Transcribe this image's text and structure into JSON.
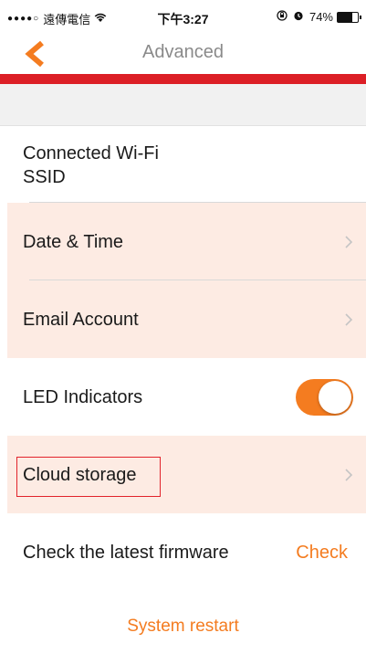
{
  "status_bar": {
    "signal": "●●●●○",
    "carrier": "遠傳電信",
    "time": "下午3:27",
    "battery_percent": "74%",
    "battery_level": 0.74
  },
  "nav": {
    "title": "Advanced"
  },
  "colors": {
    "accent": "#f47c20",
    "brand_red": "#dc1f26",
    "highlight_row": "#fdebe3",
    "outline_red": "#e2232b"
  },
  "rows": {
    "wifi": {
      "label_line1": "Connected Wi-Fi",
      "label_line2": "SSID"
    },
    "date_time": {
      "label": "Date & Time"
    },
    "email": {
      "label": "Email Account"
    },
    "led": {
      "label": "LED Indicators",
      "enabled": true
    },
    "cloud": {
      "label": "Cloud storage"
    },
    "firmware": {
      "label": "Check the latest firmware",
      "action": "Check"
    }
  },
  "footer": {
    "restart": "System restart"
  }
}
